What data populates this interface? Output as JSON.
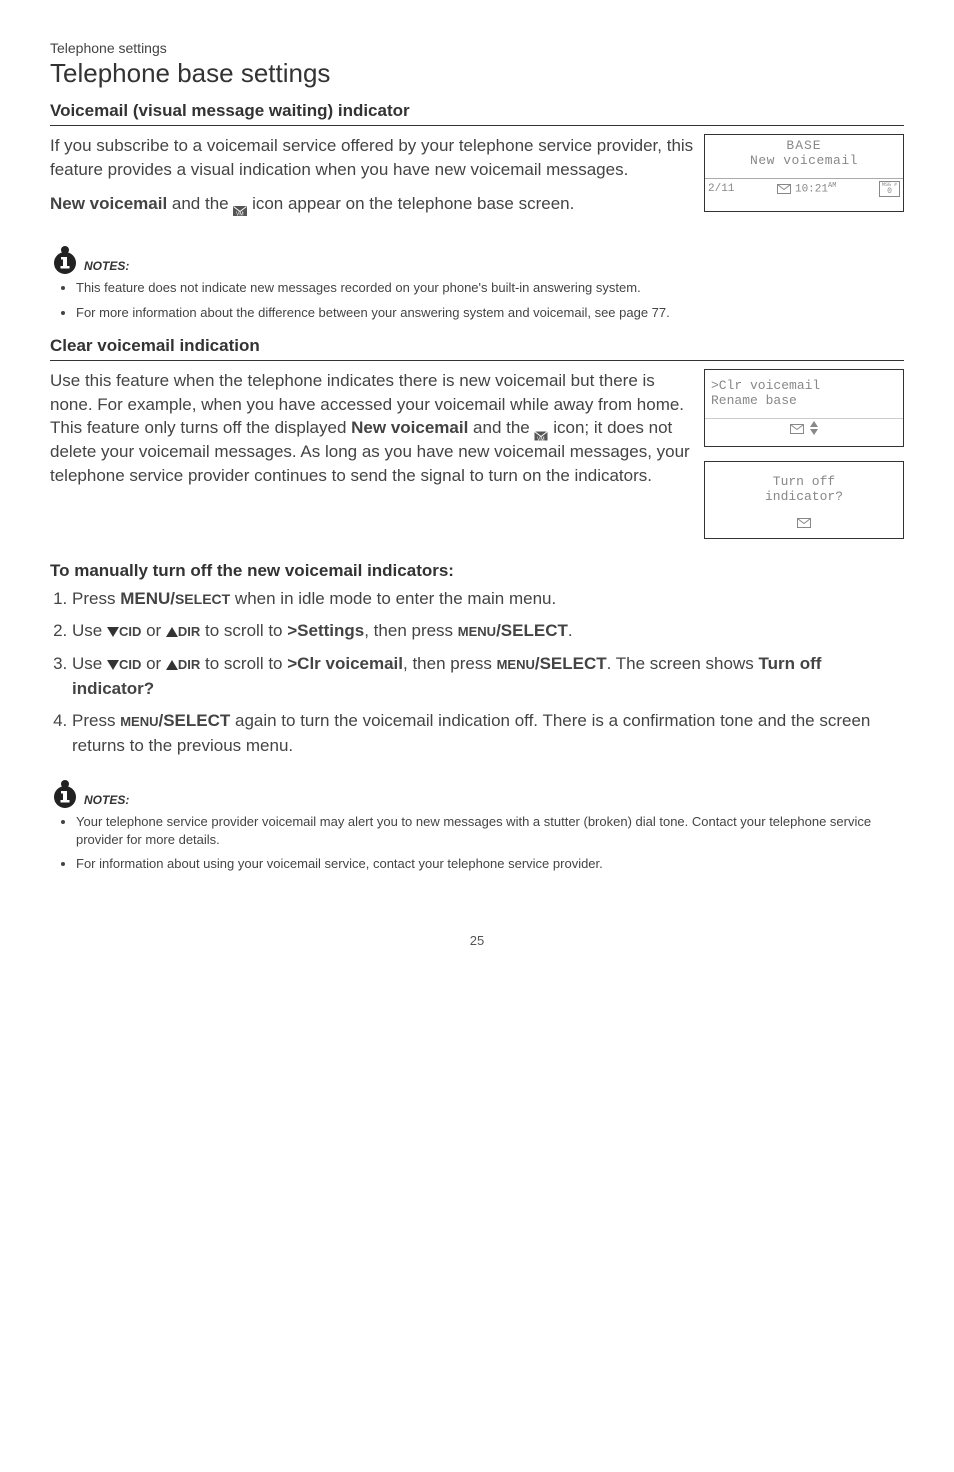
{
  "header": {
    "pretitle": "Telephone settings",
    "title": "Telephone base settings"
  },
  "section1": {
    "heading": "Voicemail (visual message waiting) indicator",
    "para1": "If you subscribe to a voicemail service offered by your telephone service provider, this feature provides a visual indication when you have new voicemail messages.",
    "para2_pre": "New voicemail",
    "para2_mid": " and the ",
    "para2_post": " icon appear on the telephone base screen."
  },
  "screen1": {
    "title": "BASE",
    "line2": "New voicemail",
    "date": "2/11",
    "time": "10:21",
    "ampm": "AM",
    "msg_label": "MSG #",
    "msg_count": "0"
  },
  "notes1": {
    "label": "NOTES:",
    "items": [
      "This feature does not indicate new messages recorded on your phone's built-in answering system.",
      "For more information about the difference between your answering system and voicemail, see page 77."
    ]
  },
  "section2": {
    "heading": "Clear voicemail indication",
    "para_a": "Use this feature when the telephone indicates there is new voicemail but there is none. For example, when you have accessed your voicemail while away from home. This feature only turns off the displayed ",
    "para_b_bold": "New voicemail",
    "para_c": " and the ",
    "para_d": " icon; it does not delete your voicemail messages. As long as you have new voicemail messages, your telephone service provider continues to send the signal to turn on the indicators."
  },
  "screen2": {
    "line1": ">Clr voicemail",
    "line2": " Rename base"
  },
  "screen3": {
    "line1": "Turn off",
    "line2": "indicator?"
  },
  "steps": {
    "heading": "To manually turn off the new voicemail indicators:",
    "s1_a": "Press ",
    "s1_b": "MENU/",
    "s1_c": "SELECT",
    "s1_d": " when in idle mode to enter the main menu.",
    "s2_a": "Use ",
    "s2_cid": "CID",
    "s2_or": " or ",
    "s2_dir": "DIR",
    "s2_b": " to scroll to ",
    "s2_target": ">Settings",
    "s2_c": ", then press ",
    "s2_menu": "MENU",
    "s2_sel": "/SELECT",
    "s2_end": ".",
    "s3_a": "Use ",
    "s3_b": " to scroll to ",
    "s3_target": ">Clr voicemail",
    "s3_c": ", then press ",
    "s3_end": ". The screen shows ",
    "s3_q": "Turn off indicator?",
    "s4_a": "Press ",
    "s4_b": " again to turn the voicemail indication off. There is a confirmation tone and the screen returns to the previous menu."
  },
  "notes2": {
    "label": "NOTES:",
    "items": [
      "Your telephone service provider voicemail may alert you to new messages with a stutter (broken) dial tone. Contact your telephone service provider for more details.",
      "For information about using your voicemail service, contact your telephone service provider."
    ]
  },
  "pagenum": "25"
}
